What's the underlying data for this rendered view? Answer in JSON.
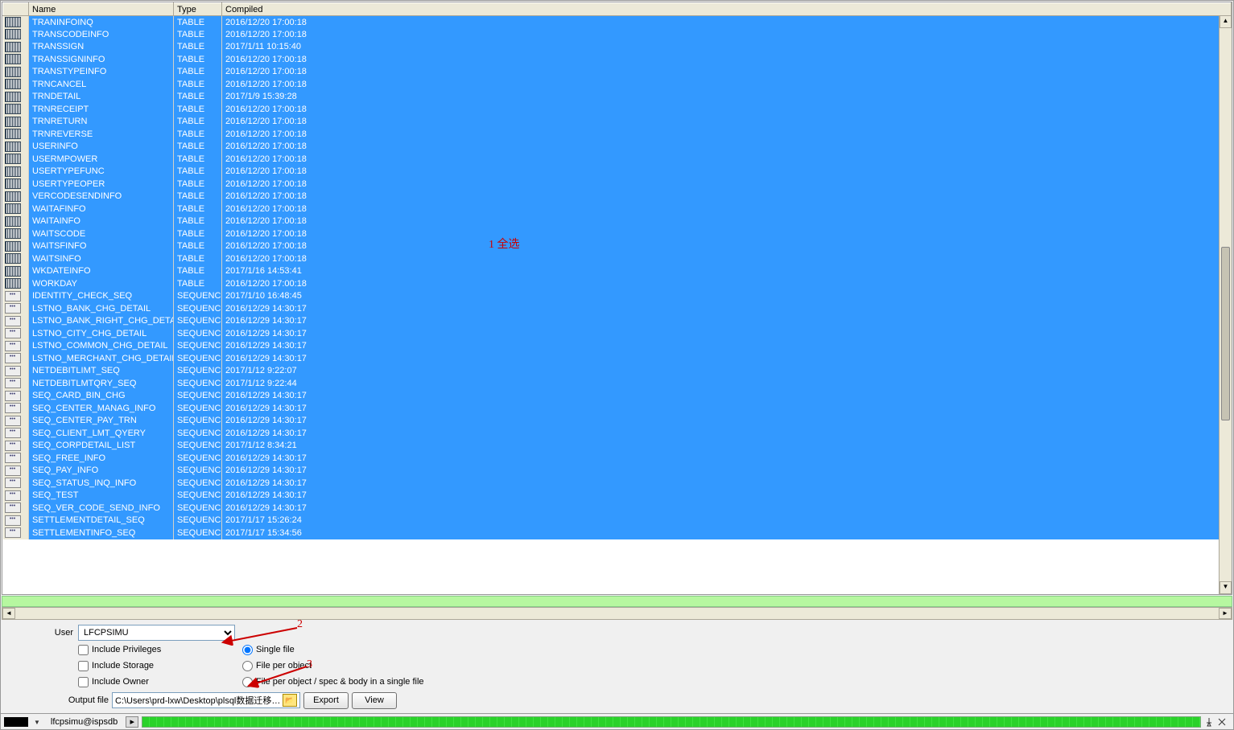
{
  "headers": {
    "name": "Name",
    "type": "Type",
    "compiled": "Compiled"
  },
  "rows": [
    {
      "icon": "table",
      "name": "TRANINFOINQ",
      "type": "TABLE",
      "compiled": "2016/12/20 17:00:18"
    },
    {
      "icon": "table",
      "name": "TRANSCODEINFO",
      "type": "TABLE",
      "compiled": "2016/12/20 17:00:18"
    },
    {
      "icon": "table",
      "name": "TRANSSIGN",
      "type": "TABLE",
      "compiled": "2017/1/11 10:15:40"
    },
    {
      "icon": "table",
      "name": "TRANSSIGNINFO",
      "type": "TABLE",
      "compiled": "2016/12/20 17:00:18"
    },
    {
      "icon": "table",
      "name": "TRANSTYPEINFO",
      "type": "TABLE",
      "compiled": "2016/12/20 17:00:18"
    },
    {
      "icon": "table",
      "name": "TRNCANCEL",
      "type": "TABLE",
      "compiled": "2016/12/20 17:00:18"
    },
    {
      "icon": "table",
      "name": "TRNDETAIL",
      "type": "TABLE",
      "compiled": "2017/1/9 15:39:28"
    },
    {
      "icon": "table",
      "name": "TRNRECEIPT",
      "type": "TABLE",
      "compiled": "2016/12/20 17:00:18"
    },
    {
      "icon": "table",
      "name": "TRNRETURN",
      "type": "TABLE",
      "compiled": "2016/12/20 17:00:18"
    },
    {
      "icon": "table",
      "name": "TRNREVERSE",
      "type": "TABLE",
      "compiled": "2016/12/20 17:00:18"
    },
    {
      "icon": "table",
      "name": "USERINFO",
      "type": "TABLE",
      "compiled": "2016/12/20 17:00:18"
    },
    {
      "icon": "table",
      "name": "USERMPOWER",
      "type": "TABLE",
      "compiled": "2016/12/20 17:00:18"
    },
    {
      "icon": "table",
      "name": "USERTYPEFUNC",
      "type": "TABLE",
      "compiled": "2016/12/20 17:00:18"
    },
    {
      "icon": "table",
      "name": "USERTYPEOPER",
      "type": "TABLE",
      "compiled": "2016/12/20 17:00:18"
    },
    {
      "icon": "table",
      "name": "VERCODESENDINFO",
      "type": "TABLE",
      "compiled": "2016/12/20 17:00:18"
    },
    {
      "icon": "table",
      "name": "WAITAFINFO",
      "type": "TABLE",
      "compiled": "2016/12/20 17:00:18"
    },
    {
      "icon": "table",
      "name": "WAITAINFO",
      "type": "TABLE",
      "compiled": "2016/12/20 17:00:18"
    },
    {
      "icon": "table",
      "name": "WAITSCODE",
      "type": "TABLE",
      "compiled": "2016/12/20 17:00:18"
    },
    {
      "icon": "table",
      "name": "WAITSFINFO",
      "type": "TABLE",
      "compiled": "2016/12/20 17:00:18"
    },
    {
      "icon": "table",
      "name": "WAITSINFO",
      "type": "TABLE",
      "compiled": "2016/12/20 17:00:18"
    },
    {
      "icon": "table",
      "name": "WKDATEINFO",
      "type": "TABLE",
      "compiled": "2017/1/16 14:53:41"
    },
    {
      "icon": "table",
      "name": "WORKDAY",
      "type": "TABLE",
      "compiled": "2016/12/20 17:00:18"
    },
    {
      "icon": "sequence",
      "name": "IDENTITY_CHECK_SEQ",
      "type": "SEQUENCE",
      "compiled": "2017/1/10 16:48:45"
    },
    {
      "icon": "sequence",
      "name": "LSTNO_BANK_CHG_DETAIL",
      "type": "SEQUENCE",
      "compiled": "2016/12/29 14:30:17"
    },
    {
      "icon": "sequence",
      "name": "LSTNO_BANK_RIGHT_CHG_DETAIL",
      "type": "SEQUENCE",
      "compiled": "2016/12/29 14:30:17"
    },
    {
      "icon": "sequence",
      "name": "LSTNO_CITY_CHG_DETAIL",
      "type": "SEQUENCE",
      "compiled": "2016/12/29 14:30:17"
    },
    {
      "icon": "sequence",
      "name": "LSTNO_COMMON_CHG_DETAIL",
      "type": "SEQUENCE",
      "compiled": "2016/12/29 14:30:17"
    },
    {
      "icon": "sequence",
      "name": "LSTNO_MERCHANT_CHG_DETAIL",
      "type": "SEQUENCE",
      "compiled": "2016/12/29 14:30:17"
    },
    {
      "icon": "sequence",
      "name": "NETDEBITLIMT_SEQ",
      "type": "SEQUENCE",
      "compiled": "2017/1/12 9:22:07"
    },
    {
      "icon": "sequence",
      "name": "NETDEBITLMTQRY_SEQ",
      "type": "SEQUENCE",
      "compiled": "2017/1/12 9:22:44"
    },
    {
      "icon": "sequence",
      "name": "SEQ_CARD_BIN_CHG",
      "type": "SEQUENCE",
      "compiled": "2016/12/29 14:30:17"
    },
    {
      "icon": "sequence",
      "name": "SEQ_CENTER_MANAG_INFO",
      "type": "SEQUENCE",
      "compiled": "2016/12/29 14:30:17"
    },
    {
      "icon": "sequence",
      "name": "SEQ_CENTER_PAY_TRN",
      "type": "SEQUENCE",
      "compiled": "2016/12/29 14:30:17"
    },
    {
      "icon": "sequence",
      "name": "SEQ_CLIENT_LMT_QYERY",
      "type": "SEQUENCE",
      "compiled": "2016/12/29 14:30:17"
    },
    {
      "icon": "sequence",
      "name": "SEQ_CORPDETAIL_LIST",
      "type": "SEQUENCE",
      "compiled": "2017/1/12 8:34:21"
    },
    {
      "icon": "sequence",
      "name": "SEQ_FREE_INFO",
      "type": "SEQUENCE",
      "compiled": "2016/12/29 14:30:17"
    },
    {
      "icon": "sequence",
      "name": "SEQ_PAY_INFO",
      "type": "SEQUENCE",
      "compiled": "2016/12/29 14:30:17"
    },
    {
      "icon": "sequence",
      "name": "SEQ_STATUS_INQ_INFO",
      "type": "SEQUENCE",
      "compiled": "2016/12/29 14:30:17"
    },
    {
      "icon": "sequence",
      "name": "SEQ_TEST",
      "type": "SEQUENCE",
      "compiled": "2016/12/29 14:30:17"
    },
    {
      "icon": "sequence",
      "name": "SEQ_VER_CODE_SEND_INFO",
      "type": "SEQUENCE",
      "compiled": "2016/12/29 14:30:17"
    },
    {
      "icon": "sequence",
      "name": "SETTLEMENTDETAIL_SEQ",
      "type": "SEQUENCE",
      "compiled": "2017/1/17 15:26:24"
    },
    {
      "icon": "sequence",
      "name": "SETTLEMENTINFO_SEQ",
      "type": "SEQUENCE",
      "compiled": "2017/1/17 15:34:56"
    }
  ],
  "annotations": {
    "a1": "1 全选",
    "a2": "2",
    "a3": "3"
  },
  "options": {
    "user_label": "User",
    "user_value": "LFCPSIMU",
    "include_privileges": "Include Privileges",
    "include_storage": "Include Storage",
    "include_owner": "Include Owner",
    "radio_single": "Single file",
    "radio_per_object": "File per object",
    "radio_per_spec": "File per object / spec & body in a single file",
    "output_label": "Output file",
    "output_value": "C:\\Users\\prd-lxw\\Desktop\\plsql数据迁移\\tables.",
    "export_btn": "Export",
    "view_btn": "View"
  },
  "status": {
    "connection": "lfcpsimu@ispsdb"
  }
}
